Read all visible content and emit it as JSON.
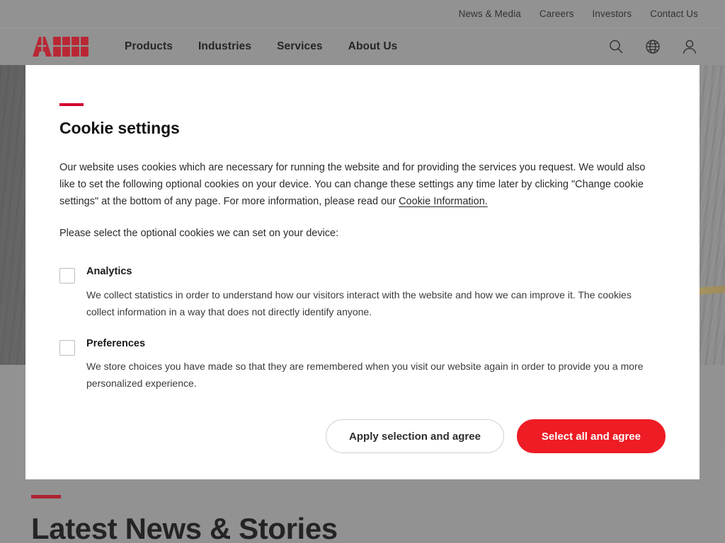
{
  "header": {
    "utility_links": [
      {
        "label": "News & Media"
      },
      {
        "label": "Careers"
      },
      {
        "label": "Investors"
      },
      {
        "label": "Contact Us"
      }
    ],
    "logo_text": "ABB",
    "nav_items": [
      {
        "label": "Products"
      },
      {
        "label": "Industries"
      },
      {
        "label": "Services"
      },
      {
        "label": "About Us"
      }
    ],
    "icons": [
      {
        "name": "search-icon"
      },
      {
        "name": "globe-icon"
      },
      {
        "name": "user-icon"
      }
    ]
  },
  "modal": {
    "title": "Cookie settings",
    "paragraph_1_before_link": "Our website uses cookies which are necessary for running the website and for providing the services you request. We would also like to set the following optional cookies on your device. You can change these settings any time later by clicking \"Change cookie settings\" at the bottom of any page. For more information, please read our ",
    "link_text": "Cookie Information.",
    "paragraph_2": "Please select the optional cookies we can set on your device:",
    "options": [
      {
        "label": "Analytics",
        "description": "We collect statistics in order to understand how our visitors interact with the website and how we can improve it. The cookies collect information in a way that does not directly identify anyone.",
        "checked": false
      },
      {
        "label": "Preferences",
        "description": "We store choices you have made so that they are remembered when you visit our website again in order to provide you a more personalized experience.",
        "checked": false
      }
    ],
    "secondary_button": "Apply selection and agree",
    "primary_button": "Select all and agree"
  },
  "news_section": {
    "title": "Latest News & Stories"
  },
  "colors": {
    "brand_red": "#ee1c25",
    "logo_red": "#cc1122",
    "accent_bar_modal": "#d2002e",
    "accent_bar_news": "#be0c20",
    "page_grey": "#9a9a9a",
    "modal_white": "#ffffff"
  }
}
